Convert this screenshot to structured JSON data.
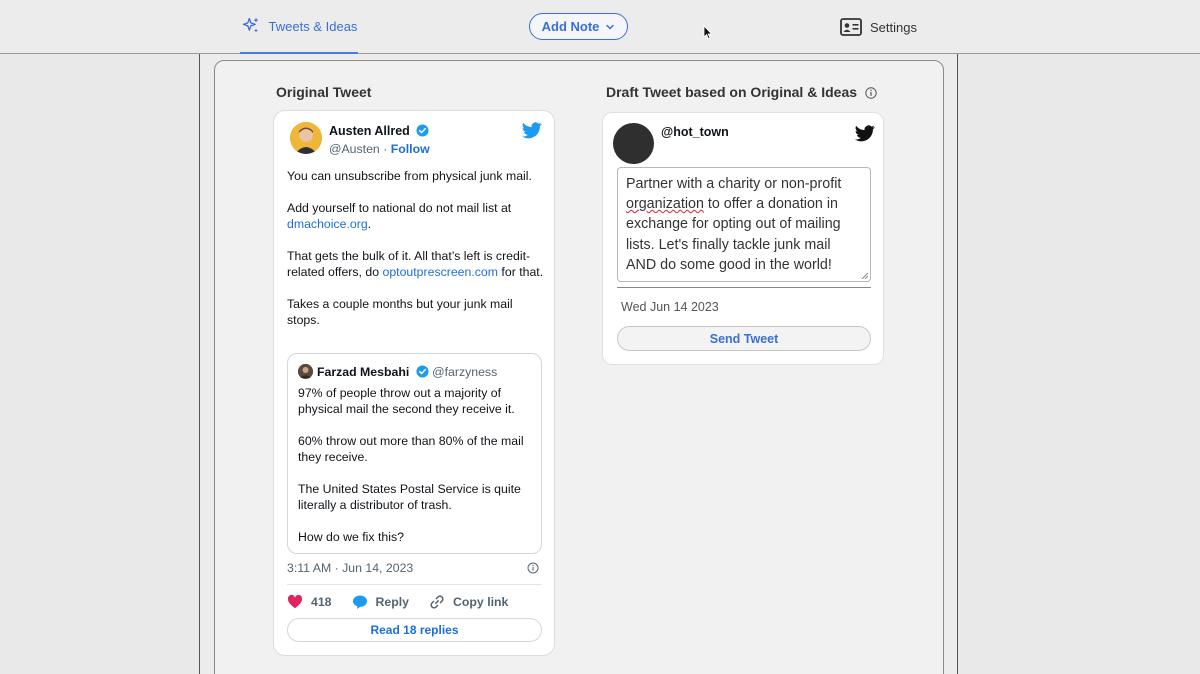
{
  "nav": {
    "tweets_tab": "Tweets & Ideas",
    "add_note": "Add Note",
    "settings": "Settings",
    "accent_color": "#3a6fd6"
  },
  "original": {
    "title": "Original Tweet",
    "author_name": "Austen Allred",
    "author_handle": "@Austen",
    "separator": "·",
    "follow": "Follow",
    "body_p1": "You can unsubscribe from physical junk mail.",
    "body_p2_pre": "Add yourself to national do not mail list at ",
    "body_p2_link": "dmachoice.org",
    "body_p2_post": ".",
    "body_p3_pre": "That gets the bulk of it. All that’s left is credit-related offers, do ",
    "body_p3_link": "optoutprescreen.com",
    "body_p3_post": " for that.",
    "body_p4": "Takes a couple months but your junk mail stops.",
    "quote": {
      "author_name": "Farzad Mesbahi",
      "author_handle": "@farzyness",
      "p1": "97% of people throw out a majority of physical mail the second they receive it.",
      "p2": "60% throw out more than 80% of the mail they receive.",
      "p3": "The United States Postal Service is quite literally a distributor of trash.",
      "p4": "How do we fix this?"
    },
    "timestamp": "3:11 AM · Jun 14, 2023",
    "likes": "418",
    "reply": "Reply",
    "copy_link": "Copy link",
    "read_replies": "Read 18 replies",
    "link_color": "#1d6fd8",
    "heart_color": "#e0245e"
  },
  "draft": {
    "title": "Draft Tweet based on Original & Ideas",
    "handle": "@hot_town",
    "text_pre": "Partner with a charity or non-profit ",
    "text_misspelled": "organization",
    "text_post": " to offer a donation in exchange for opting out of mailing lists. Let's finally tackle junk mail AND do some good in the world!",
    "date": "Wed Jun 14 2023",
    "send": "Send Tweet"
  },
  "icons": {
    "tweets_tab": "sparkles-icon",
    "add_note": "chevron-down-icon",
    "settings": "id-card-icon",
    "info": "info-icon",
    "verified": "verified-badge-icon",
    "brand": "twitter-bird-icon",
    "like": "heart-icon",
    "reply": "speech-bubble-icon",
    "copy": "link-icon",
    "cursor": "mouse-pointer-icon"
  }
}
